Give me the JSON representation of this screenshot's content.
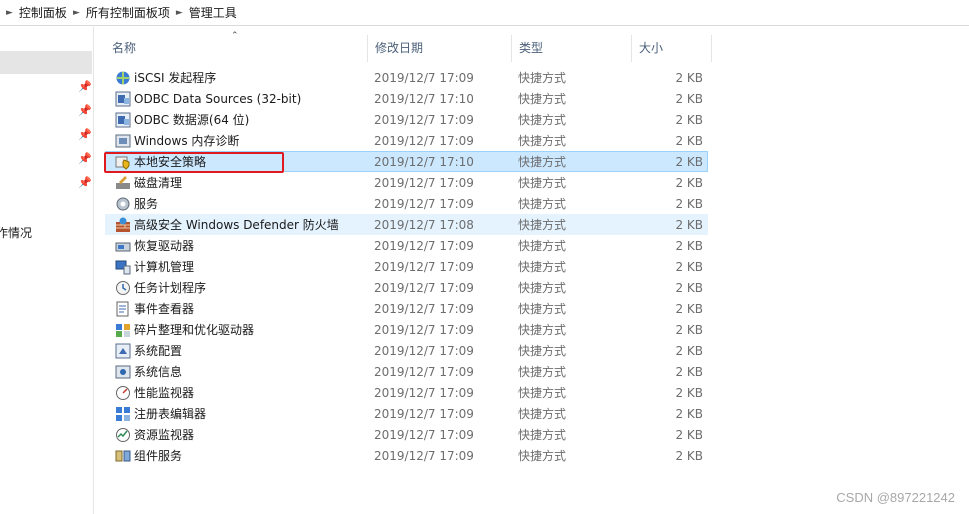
{
  "breadcrumb": [
    "控制面板",
    "所有控制面板项",
    "管理工具"
  ],
  "nav": {
    "partial_label": "作情况"
  },
  "columns": {
    "name": "名称",
    "date": "修改日期",
    "type": "类型",
    "size": "大小"
  },
  "files": [
    {
      "name": "iSCSI 发起程序",
      "date": "2019/12/7 17:09",
      "type": "快捷方式",
      "size": "2 KB",
      "icon": "iscsi-icon"
    },
    {
      "name": "ODBC Data Sources (32-bit)",
      "date": "2019/12/7 17:10",
      "type": "快捷方式",
      "size": "2 KB",
      "icon": "odbc-icon"
    },
    {
      "name": "ODBC 数据源(64 位)",
      "date": "2019/12/7 17:09",
      "type": "快捷方式",
      "size": "2 KB",
      "icon": "odbc-icon"
    },
    {
      "name": "Windows 内存诊断",
      "date": "2019/12/7 17:09",
      "type": "快捷方式",
      "size": "2 KB",
      "icon": "memory-diagnostic-icon"
    },
    {
      "name": "本地安全策略",
      "date": "2019/12/7 17:10",
      "type": "快捷方式",
      "size": "2 KB",
      "icon": "security-policy-icon"
    },
    {
      "name": "磁盘清理",
      "date": "2019/12/7 17:09",
      "type": "快捷方式",
      "size": "2 KB",
      "icon": "disk-cleanup-icon"
    },
    {
      "name": "服务",
      "date": "2019/12/7 17:09",
      "type": "快捷方式",
      "size": "2 KB",
      "icon": "services-icon"
    },
    {
      "name": "高级安全 Windows Defender 防火墙",
      "date": "2019/12/7 17:08",
      "type": "快捷方式",
      "size": "2 KB",
      "icon": "firewall-icon"
    },
    {
      "name": "恢复驱动器",
      "date": "2019/12/7 17:09",
      "type": "快捷方式",
      "size": "2 KB",
      "icon": "recovery-drive-icon"
    },
    {
      "name": "计算机管理",
      "date": "2019/12/7 17:09",
      "type": "快捷方式",
      "size": "2 KB",
      "icon": "computer-management-icon"
    },
    {
      "name": "任务计划程序",
      "date": "2019/12/7 17:09",
      "type": "快捷方式",
      "size": "2 KB",
      "icon": "task-scheduler-icon"
    },
    {
      "name": "事件查看器",
      "date": "2019/12/7 17:09",
      "type": "快捷方式",
      "size": "2 KB",
      "icon": "event-viewer-icon"
    },
    {
      "name": "碎片整理和优化驱动器",
      "date": "2019/12/7 17:09",
      "type": "快捷方式",
      "size": "2 KB",
      "icon": "defrag-icon"
    },
    {
      "name": "系统配置",
      "date": "2019/12/7 17:09",
      "type": "快捷方式",
      "size": "2 KB",
      "icon": "system-config-icon"
    },
    {
      "name": "系统信息",
      "date": "2019/12/7 17:09",
      "type": "快捷方式",
      "size": "2 KB",
      "icon": "system-info-icon"
    },
    {
      "name": "性能监视器",
      "date": "2019/12/7 17:09",
      "type": "快捷方式",
      "size": "2 KB",
      "icon": "performance-monitor-icon"
    },
    {
      "name": "注册表编辑器",
      "date": "2019/12/7 17:09",
      "type": "快捷方式",
      "size": "2 KB",
      "icon": "registry-editor-icon"
    },
    {
      "name": "资源监视器",
      "date": "2019/12/7 17:09",
      "type": "快捷方式",
      "size": "2 KB",
      "icon": "resource-monitor-icon"
    },
    {
      "name": "组件服务",
      "date": "2019/12/7 17:09",
      "type": "快捷方式",
      "size": "2 KB",
      "icon": "component-services-icon"
    }
  ],
  "selected_index": 4,
  "hover_index": 7,
  "colors": {
    "selection": "#cce8ff",
    "hover": "#e5f3ff",
    "highlight_box": "#e0191f"
  },
  "watermark": "CSDN @897221242"
}
